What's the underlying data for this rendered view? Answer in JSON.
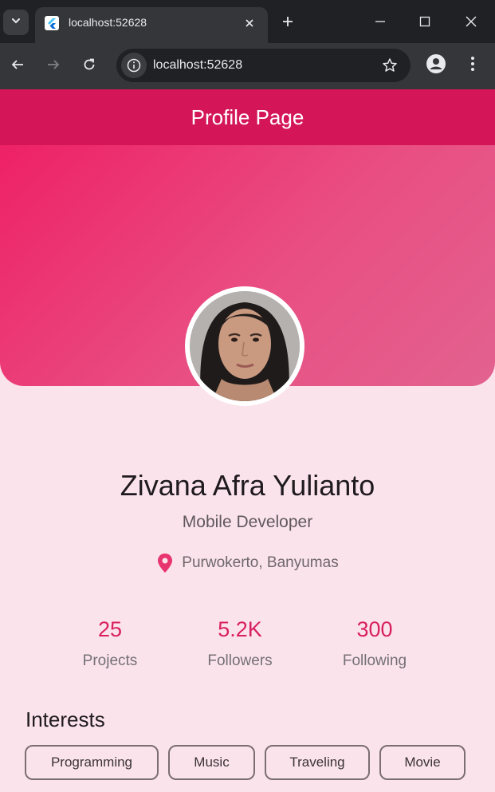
{
  "browser": {
    "tab_title": "localhost:52628",
    "url": "localhost:52628"
  },
  "page": {
    "title": "Profile Page",
    "profile": {
      "name": "Zivana Afra Yulianto",
      "role": "Mobile Developer",
      "location": "Purwokerto, Banyumas"
    },
    "stats": [
      {
        "value": "25",
        "label": "Projects"
      },
      {
        "value": "5.2K",
        "label": "Followers"
      },
      {
        "value": "300",
        "label": "Following"
      }
    ],
    "interests_title": "Interests",
    "interests": [
      "Programming",
      "Music",
      "Traveling",
      "Movie"
    ]
  },
  "colors": {
    "app_bar": "#d41658",
    "accent": "#d9205f",
    "background": "#fbe3ec",
    "location_pin": "#e8356f"
  },
  "icons": {
    "tab_list": "chevron-down-icon",
    "favicon": "flutter-logo-icon",
    "close": "close-icon",
    "new_tab": "plus-icon",
    "back": "arrow-left-icon",
    "forward": "arrow-right-icon",
    "reload": "reload-icon",
    "site_info": "info-icon",
    "bookmark": "star-icon",
    "account": "account-icon",
    "menu": "kebab-menu-icon",
    "location": "location-pin-icon"
  }
}
